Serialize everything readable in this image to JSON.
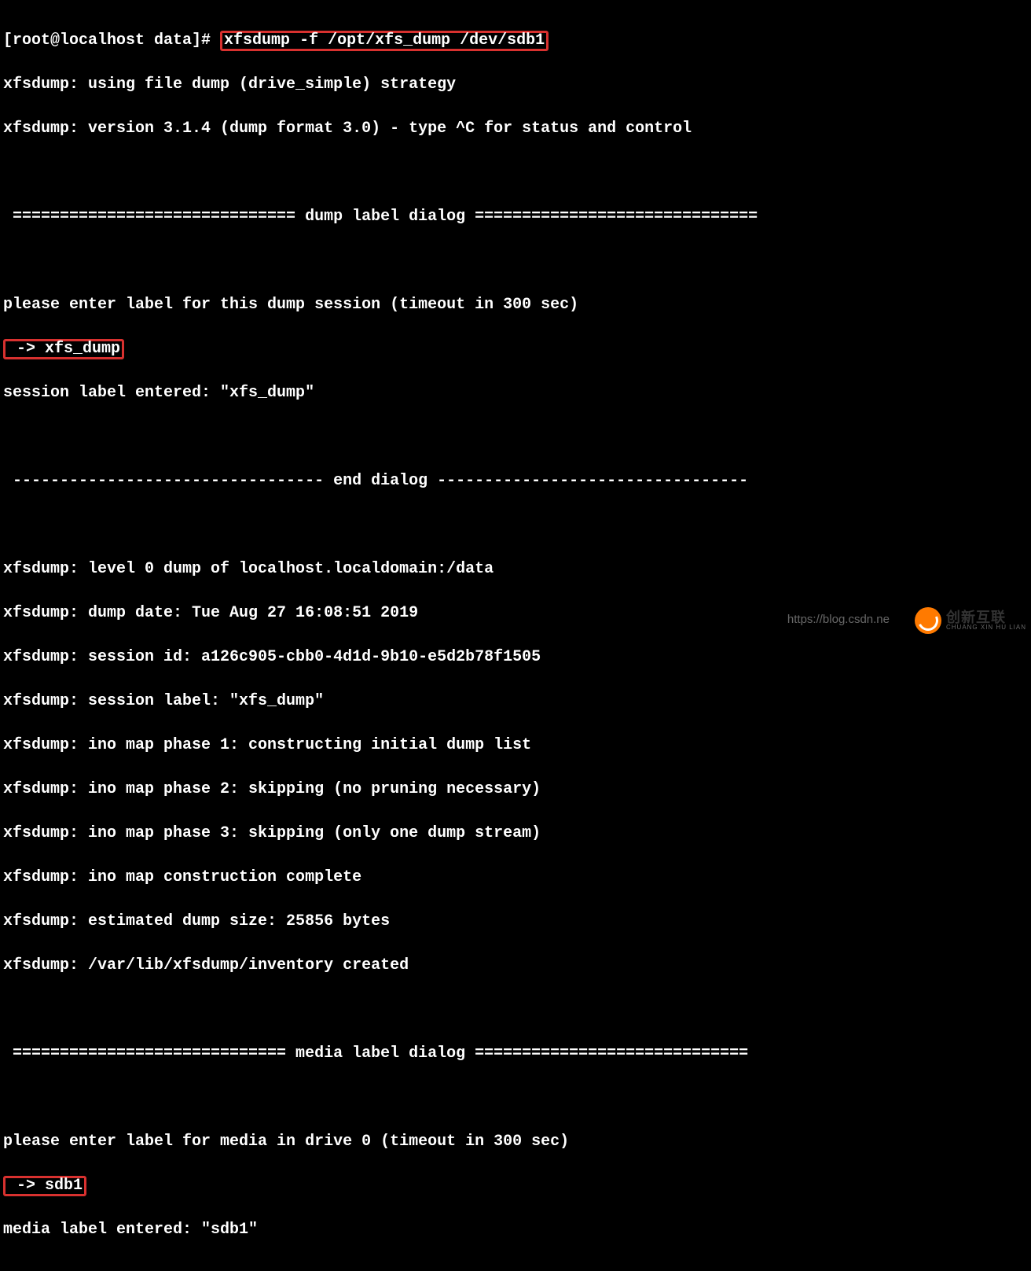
{
  "prompt": "[root@localhost data]# ",
  "command": "xfsdump -f /opt/xfs_dump /dev/sdb1",
  "out1": "xfsdump: using file dump (drive_simple) strategy",
  "out2": "xfsdump: version 3.1.4 (dump format 3.0) - type ^C for status and control",
  "hdr1": " ============================== dump label dialog ==============================",
  "ask1": "please enter label for this dump session (timeout in 300 sec)",
  "arrow": " -> ",
  "input1": "xfs_dump",
  "conf1": "session label entered: \"xfs_dump\"",
  "end1": " --------------------------------- end dialog ---------------------------------",
  "o3": "xfsdump: level 0 dump of localhost.localdomain:/data",
  "o4": "xfsdump: dump date: Tue Aug 27 16:08:51 2019",
  "o5": "xfsdump: session id: a126c905-cbb0-4d1d-9b10-e5d2b78f1505",
  "o6": "xfsdump: session label: \"xfs_dump\"",
  "o7": "xfsdump: ino map phase 1: constructing initial dump list",
  "o8": "xfsdump: ino map phase 2: skipping (no pruning necessary)",
  "o9": "xfsdump: ino map phase 3: skipping (only one dump stream)",
  "o10": "xfsdump: ino map construction complete",
  "o11": "xfsdump: estimated dump size: 25856 bytes",
  "o12": "xfsdump: /var/lib/xfsdump/inventory created",
  "hdr2": " ============================= media label dialog =============================",
  "ask2": "please enter label for media in drive 0 (timeout in 300 sec)",
  "input2": "sdb1",
  "conf2": "media label entered: \"sdb1\"",
  "watermark_url": "https://blog.csdn.ne",
  "watermark_cn": "创新互联",
  "watermark_en": "CHUANG XIN HU LIAN"
}
